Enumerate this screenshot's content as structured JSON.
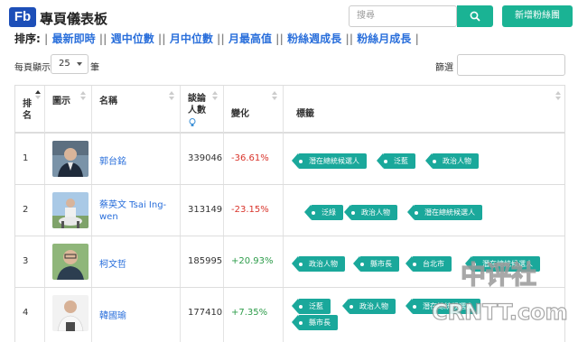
{
  "header": {
    "logo": "Fb",
    "title": "專頁儀表板",
    "search_placeholder": "搜尋",
    "add_button": "新增粉絲團"
  },
  "sortbar": {
    "label": "排序:",
    "links": [
      "最新即時",
      "週中位數",
      "月中位數",
      "月最高值",
      "粉絲週成長",
      "粉絲月成長"
    ]
  },
  "controls": {
    "page_size_label": "每頁顯示",
    "page_size_value": "25",
    "page_size_unit": "筆",
    "filter_label": "篩選"
  },
  "table": {
    "columns": [
      "排名",
      "圖示",
      "名稱",
      "談論人數",
      "變化",
      "標籤"
    ],
    "rows": [
      {
        "rank": "1",
        "name": "郭台銘",
        "count": "339046",
        "change": "-36.61%",
        "tags": [
          "潛在總統候選人",
          "泛藍",
          "政治人物"
        ]
      },
      {
        "rank": "2",
        "name": "蔡英文 Tsai Ing-wen",
        "count": "313149",
        "change": "-23.15%",
        "tags": [
          "泛綠",
          "政治人物",
          "潛在總統候選人"
        ]
      },
      {
        "rank": "3",
        "name": "柯文哲",
        "count": "185995",
        "change": "+20.93%",
        "tags": [
          "政治人物",
          "縣市長",
          "台北市",
          "潛在總統候選人"
        ]
      },
      {
        "rank": "4",
        "name": "韓國瑜",
        "count": "177410",
        "change": "+7.35%",
        "tags": [
          "泛藍",
          "政治人物",
          "潛在總統候選人",
          "縣市長"
        ]
      }
    ]
  },
  "watermark": {
    "line1": "中评社",
    "line2": "CRNTT.com"
  },
  "colors": {
    "accent": "#1ab394",
    "tag": "#1aa89b",
    "link": "#2a6fdb",
    "negative": "#d9342b",
    "positive": "#2d9c4a"
  }
}
